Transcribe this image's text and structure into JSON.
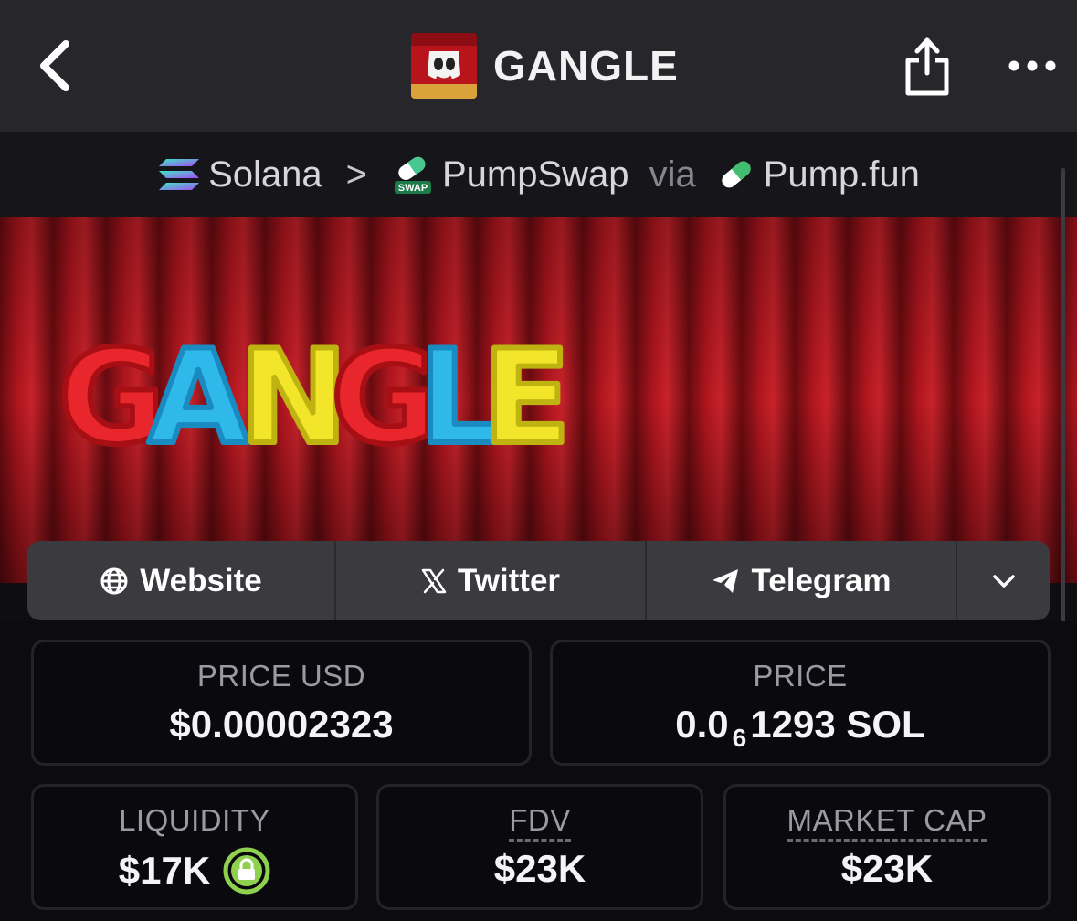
{
  "header": {
    "title": "GANGLE",
    "back_icon": "chevron-left-icon",
    "share_icon": "share-icon",
    "more_icon": "more-dots-icon"
  },
  "breadcrumb": {
    "chain": "Solana",
    "separator": ">",
    "dex": "PumpSwap",
    "via": "via",
    "launchpad": "Pump.fun",
    "dex_badge": "SWAP"
  },
  "banner": {
    "text": "GANGLE"
  },
  "links": {
    "website": "Website",
    "twitter": "Twitter",
    "telegram": "Telegram"
  },
  "stats": {
    "price_usd_label": "PRICE USD",
    "price_usd_value": "$0.00002323",
    "price_label": "PRICE",
    "price_prefix": "0.0",
    "price_subscript": "6",
    "price_suffix": "1293 SOL",
    "liquidity_label": "LIQUIDITY",
    "liquidity_value": "$17K",
    "fdv_label": "FDV",
    "fdv_value": "$23K",
    "market_cap_label": "MARKET CAP",
    "market_cap_value": "$23K"
  },
  "colors": {
    "accent_lock": "#8fd14f",
    "curtain": "#b3161f"
  }
}
